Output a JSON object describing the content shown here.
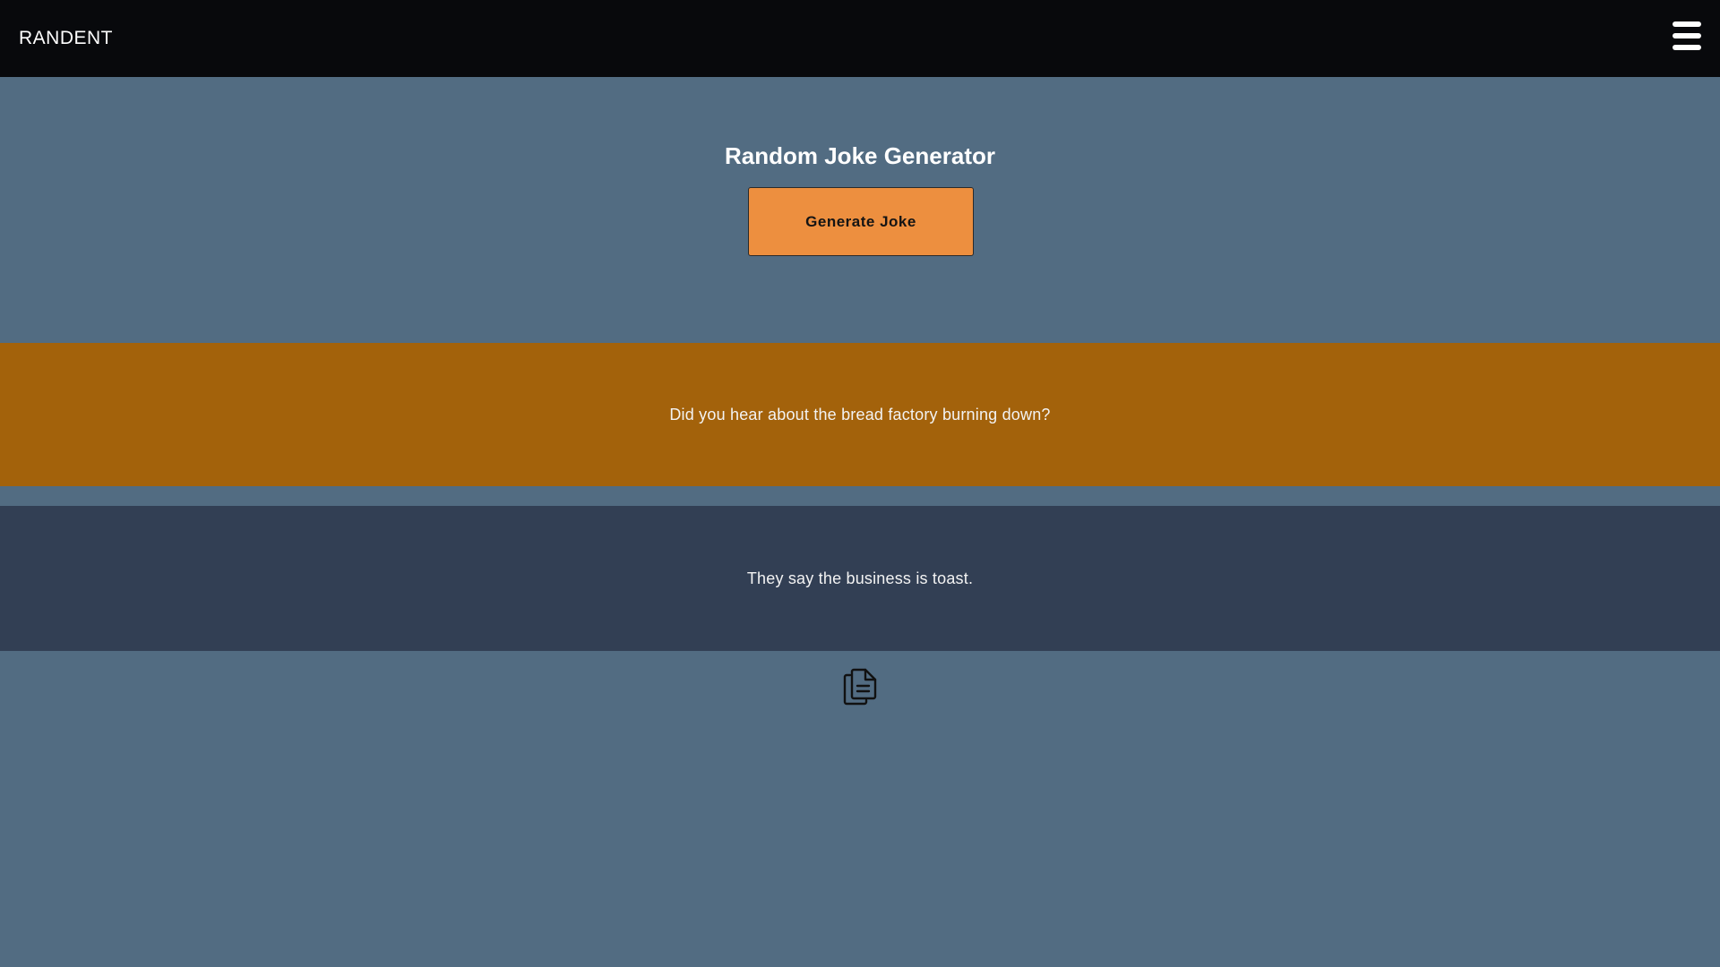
{
  "navbar": {
    "brand": "RANDENT",
    "menu_icon": "hamburger-menu-icon"
  },
  "hero": {
    "title": "Random Joke Generator",
    "generate_label": "Generate Joke"
  },
  "joke": {
    "setup": "Did you hear about the bread factory burning down?",
    "punchline": "They say the business is toast."
  },
  "actions": {
    "copy_icon": "copy-document-icon"
  },
  "colors": {
    "navbar_bg": "#08090c",
    "page_bg": "#526c82",
    "button_bg": "#ed8f3f",
    "setup_bg": "#a3620b",
    "punchline_bg": "#323f54"
  }
}
